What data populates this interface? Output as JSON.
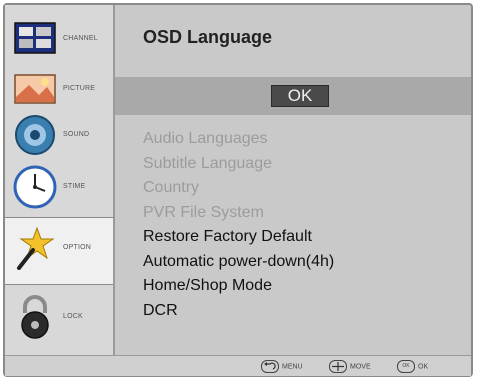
{
  "sidebar": {
    "items": [
      {
        "label": "CHANNEL",
        "icon": "channel-icon"
      },
      {
        "label": "PICTURE",
        "icon": "picture-icon"
      },
      {
        "label": "SOUND",
        "icon": "sound-icon"
      },
      {
        "label": "STIME",
        "icon": "clock-icon"
      },
      {
        "label": "OPTION",
        "icon": "star-wand-icon",
        "active": true
      },
      {
        "label": "LOCK",
        "icon": "padlock-icon"
      }
    ]
  },
  "main": {
    "title": "OSD Language",
    "ok_label": "OK",
    "options": [
      {
        "label": "Audio Languages",
        "enabled": false
      },
      {
        "label": "Subtitle Language",
        "enabled": false
      },
      {
        "label": "Country",
        "enabled": false
      },
      {
        "label": "PVR File System",
        "enabled": false
      },
      {
        "label": "Restore Factory Default",
        "enabled": true
      },
      {
        "label": "Automatic power-down(4h)",
        "enabled": true
      },
      {
        "label": "Home/Shop Mode",
        "enabled": true
      },
      {
        "label": "DCR",
        "enabled": true
      }
    ]
  },
  "footer": {
    "hints": [
      {
        "label": "MENU",
        "icon": "back-icon"
      },
      {
        "label": "MOVE",
        "icon": "dpad-icon"
      },
      {
        "label": "OK",
        "icon": "ok-icon",
        "icon_text": "OK"
      }
    ]
  },
  "colors": {
    "frame": "#c9c9c9",
    "ok_band": "#a9a9a9",
    "ok_button": "#4a4a4a",
    "disabled_text": "#9c9c9c"
  }
}
